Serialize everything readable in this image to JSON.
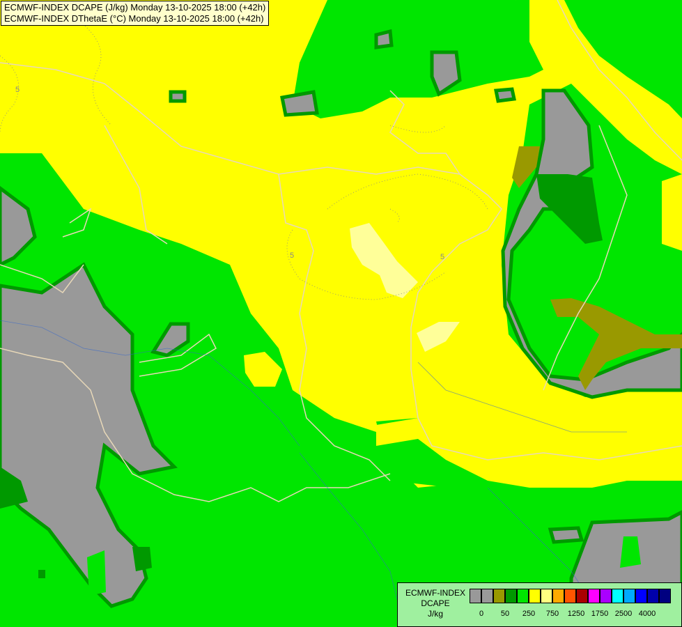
{
  "title": {
    "line1": "ECMWF-INDEX DCAPE (J/kg) Monday 13-10-2025 18:00 (+42h)",
    "line2": "ECMWF-INDEX DThetaE (°C) Monday 13-10-2025 18:00 (+42h)"
  },
  "contour_labels": [
    "5",
    "5",
    "5"
  ],
  "legend": {
    "title_line1": "ECMWF-INDEX",
    "title_line2": "DCAPE",
    "unit": "J/kg",
    "colors": [
      "#999999",
      "#999999",
      "#999900",
      "#009900",
      "#00e600",
      "#ffff00",
      "#ffff80",
      "#ffaa00",
      "#ff5500",
      "#aa0000",
      "#ff00ff",
      "#aa00ff",
      "#00ffff",
      "#00aaff",
      "#0000ff",
      "#0000aa",
      "#000080"
    ],
    "tick_labels": [
      "0",
      "50",
      "250",
      "750",
      "1250",
      "1750",
      "2500",
      "4000"
    ]
  }
}
